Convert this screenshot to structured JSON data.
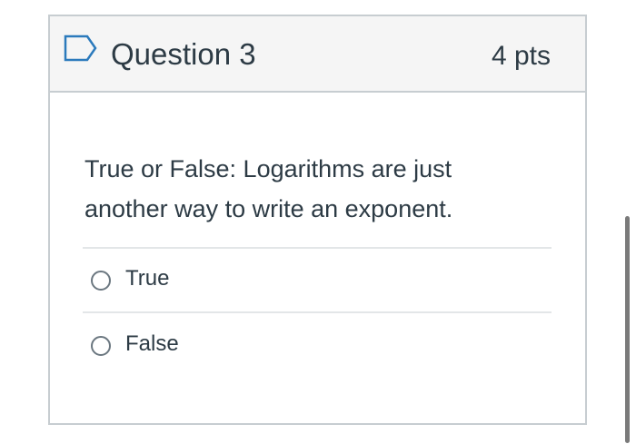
{
  "question": {
    "title": "Question 3",
    "points": "4 pts",
    "text": "True or False: Logarithms are just another way to write an exponent.",
    "flag_icon": "flag-outline-icon"
  },
  "answers": [
    {
      "label": "True",
      "selected": false
    },
    {
      "label": "False",
      "selected": false
    }
  ],
  "colors": {
    "header_bg": "#f5f5f5",
    "border": "#c7cdd1",
    "text": "#2d3b45",
    "flag": "#2b7abc"
  }
}
